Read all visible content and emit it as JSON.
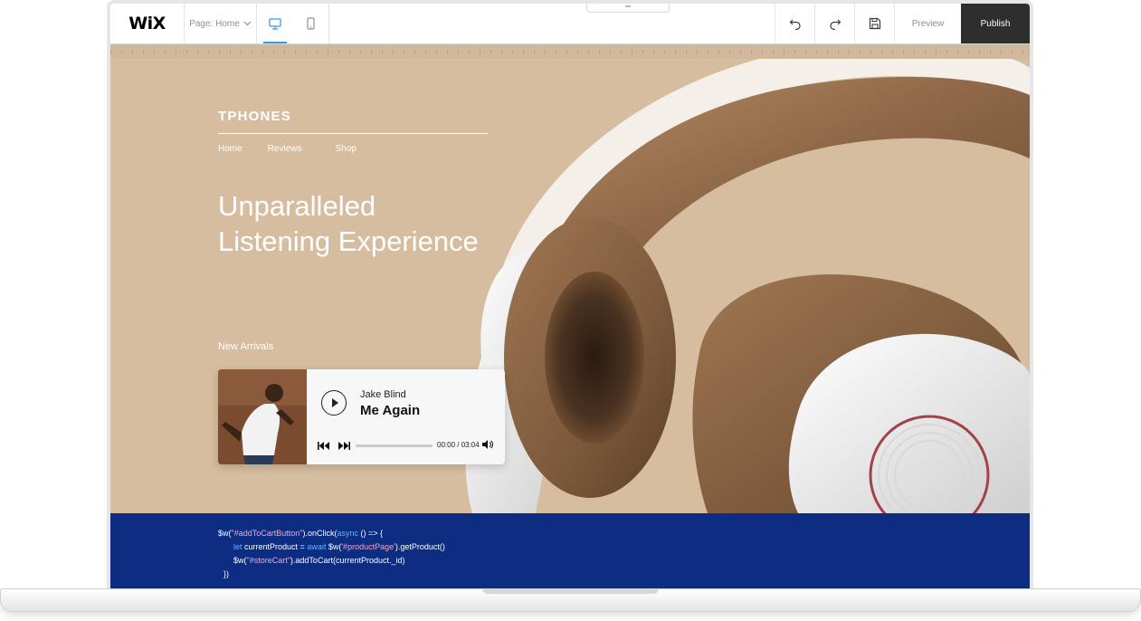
{
  "editor": {
    "logo": "WiX",
    "page_selector": "Page: Home",
    "preview_label": "Preview",
    "publish_label": "Publish",
    "active_device": "desktop",
    "icons": [
      "desktop-icon",
      "mobile-icon",
      "undo-icon",
      "redo-icon",
      "save-icon",
      "chevron-down-icon"
    ]
  },
  "site": {
    "brand": "TPHONES",
    "nav": [
      "Home",
      "Reviews",
      "Shop"
    ],
    "headline_line1": "Unparalleled",
    "headline_line2": "Listening Experience",
    "new_arrivals": "New Arrivals",
    "background_color": "#d6bda0"
  },
  "player": {
    "artist": "Jake Blind",
    "track": "Me Again",
    "time": "00:00 / 03:04",
    "progress": 0,
    "icons": [
      "play-icon",
      "previous-icon",
      "next-icon",
      "volume-icon"
    ]
  },
  "code": {
    "background_color": "#0d2d83",
    "line1": {
      "a": "$w(",
      "b": "\"#addToCartButton\"",
      "c": ").onClick(",
      "d": "async",
      "e": " () => {"
    },
    "line2": {
      "a": "let",
      "b": " currentProduct = ",
      "c": "await",
      "d": " $w(",
      "e": "'#productPage'",
      "f": ").getProduct()"
    },
    "line3": {
      "a": "$w(",
      "b": "\"#storeCart\"",
      "c": ").addToCart(currentProduct._id)"
    },
    "line4": "})"
  }
}
